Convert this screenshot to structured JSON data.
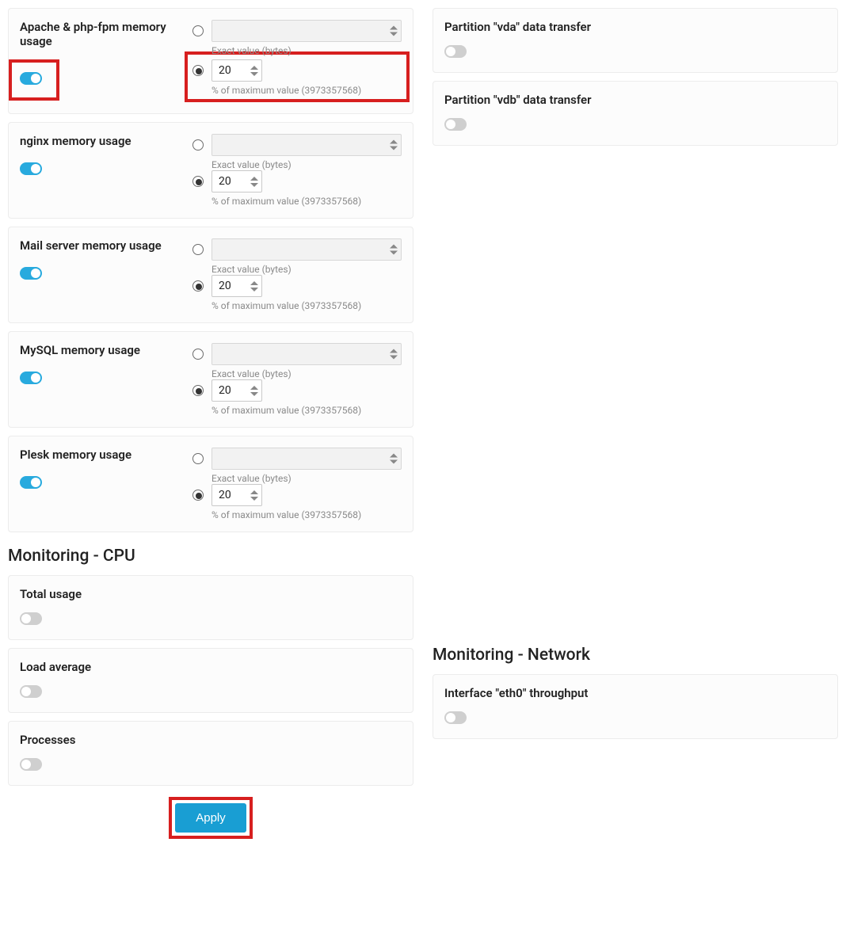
{
  "memory_cards": [
    {
      "id": "apache",
      "label": "Apache & php-fpm memory usage",
      "toggle_on": true,
      "toggle_highlight": true,
      "exact_selected": false,
      "exact_caption": "Exact value (bytes)",
      "pct_selected": true,
      "pct_value": "20",
      "pct_caption": "% of maximum value (3973357568)",
      "pct_highlight": true
    },
    {
      "id": "nginx",
      "label": "nginx memory usage",
      "toggle_on": true,
      "toggle_highlight": false,
      "exact_selected": false,
      "exact_caption": "Exact value (bytes)",
      "pct_selected": true,
      "pct_value": "20",
      "pct_caption": "% of maximum value (3973357568)",
      "pct_highlight": false
    },
    {
      "id": "mail",
      "label": "Mail server memory usage",
      "toggle_on": true,
      "toggle_highlight": false,
      "exact_selected": false,
      "exact_caption": "Exact value (bytes)",
      "pct_selected": true,
      "pct_value": "20",
      "pct_caption": "% of maximum value (3973357568)",
      "pct_highlight": false
    },
    {
      "id": "mysql",
      "label": "MySQL memory usage",
      "toggle_on": true,
      "toggle_highlight": false,
      "exact_selected": false,
      "exact_caption": "Exact value (bytes)",
      "pct_selected": true,
      "pct_value": "20",
      "pct_caption": "% of maximum value (3973357568)",
      "pct_highlight": false
    },
    {
      "id": "plesk",
      "label": "Plesk memory usage",
      "toggle_on": true,
      "toggle_highlight": false,
      "exact_selected": false,
      "exact_caption": "Exact value (bytes)",
      "pct_selected": true,
      "pct_value": "20",
      "pct_caption": "% of maximum value (3973357568)",
      "pct_highlight": false
    }
  ],
  "cpu_section_title": "Monitoring - CPU",
  "cpu_cards": [
    {
      "id": "total-usage",
      "label": "Total usage",
      "toggle_on": false
    },
    {
      "id": "load-average",
      "label": "Load average",
      "toggle_on": false
    },
    {
      "id": "processes",
      "label": "Processes",
      "toggle_on": false
    }
  ],
  "right_top_cards": [
    {
      "id": "vda",
      "label": "Partition \"vda\" data transfer",
      "toggle_on": false
    },
    {
      "id": "vdb",
      "label": "Partition \"vdb\" data transfer",
      "toggle_on": false
    }
  ],
  "network_section_title": "Monitoring - Network",
  "network_cards": [
    {
      "id": "eth0",
      "label": "Interface \"eth0\" throughput",
      "toggle_on": false
    }
  ],
  "apply_label": "Apply"
}
